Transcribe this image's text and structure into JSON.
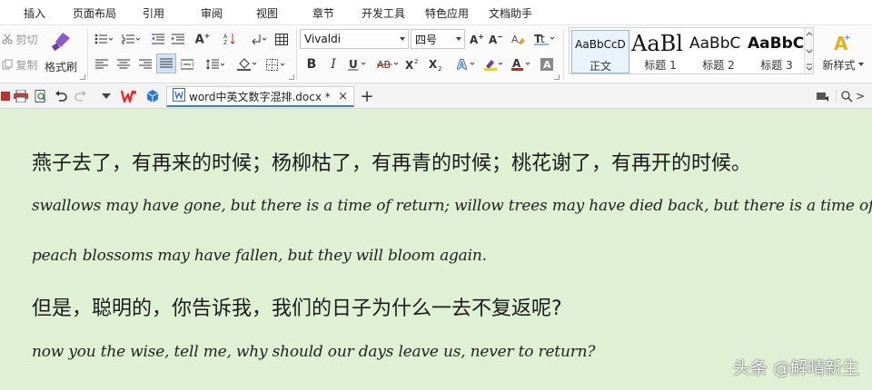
{
  "menu": {
    "items": [
      "插入",
      "页面布局",
      "引用",
      "审阅",
      "视图",
      "章节",
      "开发工具",
      "特色应用",
      "文档助手"
    ]
  },
  "clipboard": {
    "cut": "剪切",
    "copy": "复制",
    "format_painter": "格式刷"
  },
  "font": {
    "name": "Vivaldi",
    "size": "四号"
  },
  "styles": {
    "items": [
      {
        "preview": "AaBbCcD",
        "label": "正文"
      },
      {
        "preview": "AaBl",
        "label": "标题 1"
      },
      {
        "preview": "AaBbC",
        "label": "标题 2"
      },
      {
        "preview": "AaBbC",
        "label": "标题 3"
      }
    ],
    "new_style": "新样式"
  },
  "tabs": {
    "active_title": "word中英文数字混排.docx *"
  },
  "search": {
    "hint": ">"
  },
  "document": {
    "line1_zh": "燕子去了，有再来的时候；杨柳枯了，有再青的时候；桃花谢了，有再开的时候。",
    "line1_en": "swallows may have gone, but there is a time of return; willow trees may have died back, but there is a time of re-greening;",
    "line2_en": "peach blossoms may have fallen, but they will bloom again.",
    "line3_zh": "但是，聪明的，你告诉我，我们的日子为什么一去不复返呢?",
    "line3_en": "now you the wise, tell me, why should our days leave us, never to return?"
  },
  "watermark": "头条 @解晴新生",
  "colors": {
    "doc_background": "#dff0d4",
    "tab_accent": "#3a7bd5",
    "wps_red": "#e03030",
    "highlight_yellow": "#f2d600",
    "font_red": "#d02020"
  }
}
